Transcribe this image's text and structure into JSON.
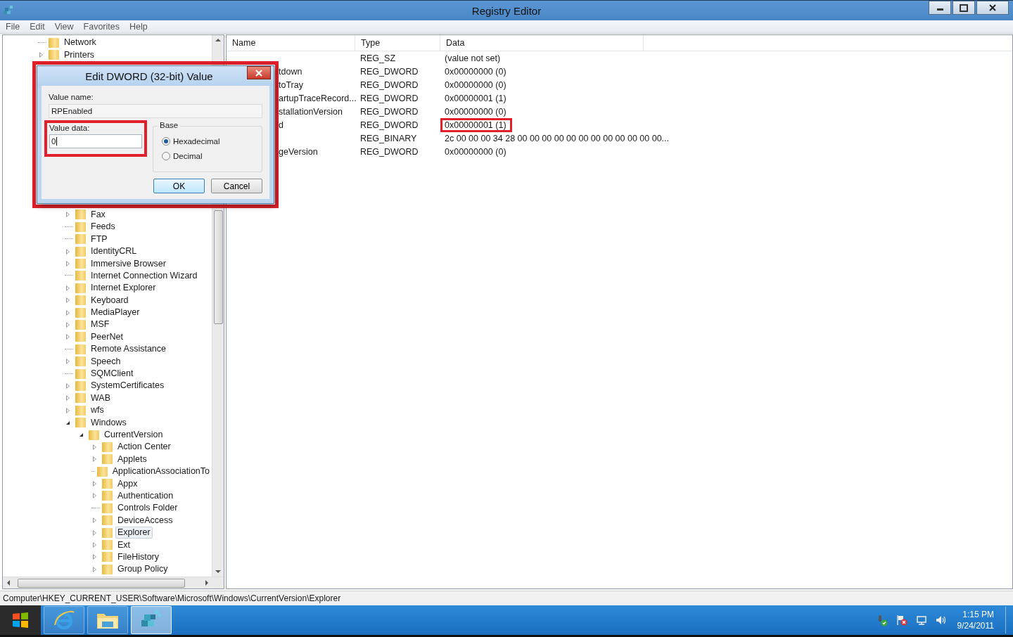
{
  "window": {
    "title": "Registry Editor"
  },
  "menu": [
    "File",
    "Edit",
    "View",
    "Favorites",
    "Help"
  ],
  "tree": {
    "top": [
      {
        "label": "Network",
        "selected": false
      },
      {
        "label": "Printers",
        "expanded": false,
        "selected": false
      }
    ],
    "lower": [
      {
        "label": "Fax",
        "expanded": false,
        "selected": false
      },
      {
        "label": "Feeds",
        "selected": false
      },
      {
        "label": "FTP",
        "selected": false
      },
      {
        "label": "IdentityCRL",
        "expanded": false,
        "selected": false
      },
      {
        "label": "Immersive Browser",
        "expanded": false,
        "selected": false
      },
      {
        "label": "Internet Connection Wizard",
        "selected": false
      },
      {
        "label": "Internet Explorer",
        "expanded": false,
        "selected": false
      },
      {
        "label": "Keyboard",
        "expanded": false,
        "selected": false
      },
      {
        "label": "MediaPlayer",
        "expanded": false,
        "selected": false
      },
      {
        "label": "MSF",
        "expanded": false,
        "selected": false
      },
      {
        "label": "PeerNet",
        "expanded": false,
        "selected": false
      },
      {
        "label": "Remote Assistance",
        "selected": false
      },
      {
        "label": "Speech",
        "expanded": false,
        "selected": false
      },
      {
        "label": "SQMClient",
        "selected": false
      },
      {
        "label": "SystemCertificates",
        "expanded": false,
        "selected": false
      },
      {
        "label": "WAB",
        "expanded": false,
        "selected": false
      },
      {
        "label": "wfs",
        "expanded": false,
        "selected": false
      },
      {
        "label": "Windows",
        "expanded": true,
        "selected": false,
        "children": [
          {
            "label": "CurrentVersion",
            "expanded": true,
            "selected": false,
            "children": [
              {
                "label": "Action Center",
                "expanded": false,
                "selected": false
              },
              {
                "label": "Applets",
                "expanded": false,
                "selected": false
              },
              {
                "label": "ApplicationAssociationTo",
                "selected": false
              },
              {
                "label": "Appx",
                "expanded": false,
                "selected": false
              },
              {
                "label": "Authentication",
                "expanded": false,
                "selected": false
              },
              {
                "label": "Controls Folder",
                "selected": false
              },
              {
                "label": "DeviceAccess",
                "expanded": false,
                "selected": false
              },
              {
                "label": "Explorer",
                "expanded": false,
                "selected": true
              },
              {
                "label": "Ext",
                "expanded": false,
                "selected": false
              },
              {
                "label": "FileHistory",
                "expanded": false,
                "selected": false
              },
              {
                "label": "Group Policy",
                "expanded": false,
                "selected": false
              }
            ]
          }
        ]
      }
    ]
  },
  "list": {
    "columns": [
      "Name",
      "Type",
      "Data"
    ],
    "rows": [
      {
        "type": "REG_SZ",
        "data": "(value not set)",
        "highlighted": false
      },
      {
        "name": "tdown",
        "type": "REG_DWORD",
        "data": "0x00000000 (0)",
        "highlighted": false
      },
      {
        "name": "toTray",
        "type": "REG_DWORD",
        "data": "0x00000000 (0)",
        "highlighted": false
      },
      {
        "name": "artupTraceRecord...",
        "type": "REG_DWORD",
        "data": "0x00000001 (1)",
        "highlighted": false
      },
      {
        "name": "stallationVersion",
        "type": "REG_DWORD",
        "data": "0x00000000 (0)",
        "highlighted": false
      },
      {
        "name": "d",
        "type": "REG_DWORD",
        "data": "0x00000001 (1)",
        "highlighted": true
      },
      {
        "type": "REG_BINARY",
        "data": "2c 00 00 00 34 28 00 00 00 00 00 00 00 00 00 00 00 00...",
        "highlighted": false
      },
      {
        "name": "geVersion",
        "type": "REG_DWORD",
        "data": "0x00000000 (0)",
        "highlighted": false
      }
    ]
  },
  "dialog": {
    "title": "Edit DWORD (32-bit) Value",
    "highlighted": true,
    "value_name": {
      "label": "Value name:",
      "value": "RPEnabled"
    },
    "value_data": {
      "label": "Value data:",
      "value": "0",
      "highlighted": true
    },
    "base": {
      "label": "Base",
      "options": [
        {
          "label": "Hexadecimal",
          "selected": true
        },
        {
          "label": "Decimal",
          "selected": false
        }
      ]
    },
    "buttons": [
      {
        "label": "OK",
        "kind": "default"
      },
      {
        "label": "Cancel",
        "kind": "normal"
      }
    ]
  },
  "status_bar": "Computer\\HKEY_CURRENT_USER\\Software\\Microsoft\\Windows\\CurrentVersion\\Explorer",
  "taskbar": {
    "apps": [
      {
        "kind": "browser",
        "active": false
      },
      {
        "kind": "files",
        "active": false
      },
      {
        "kind": "registry",
        "active": true
      }
    ],
    "time": "1:15 PM",
    "date": "9/24/2011"
  }
}
